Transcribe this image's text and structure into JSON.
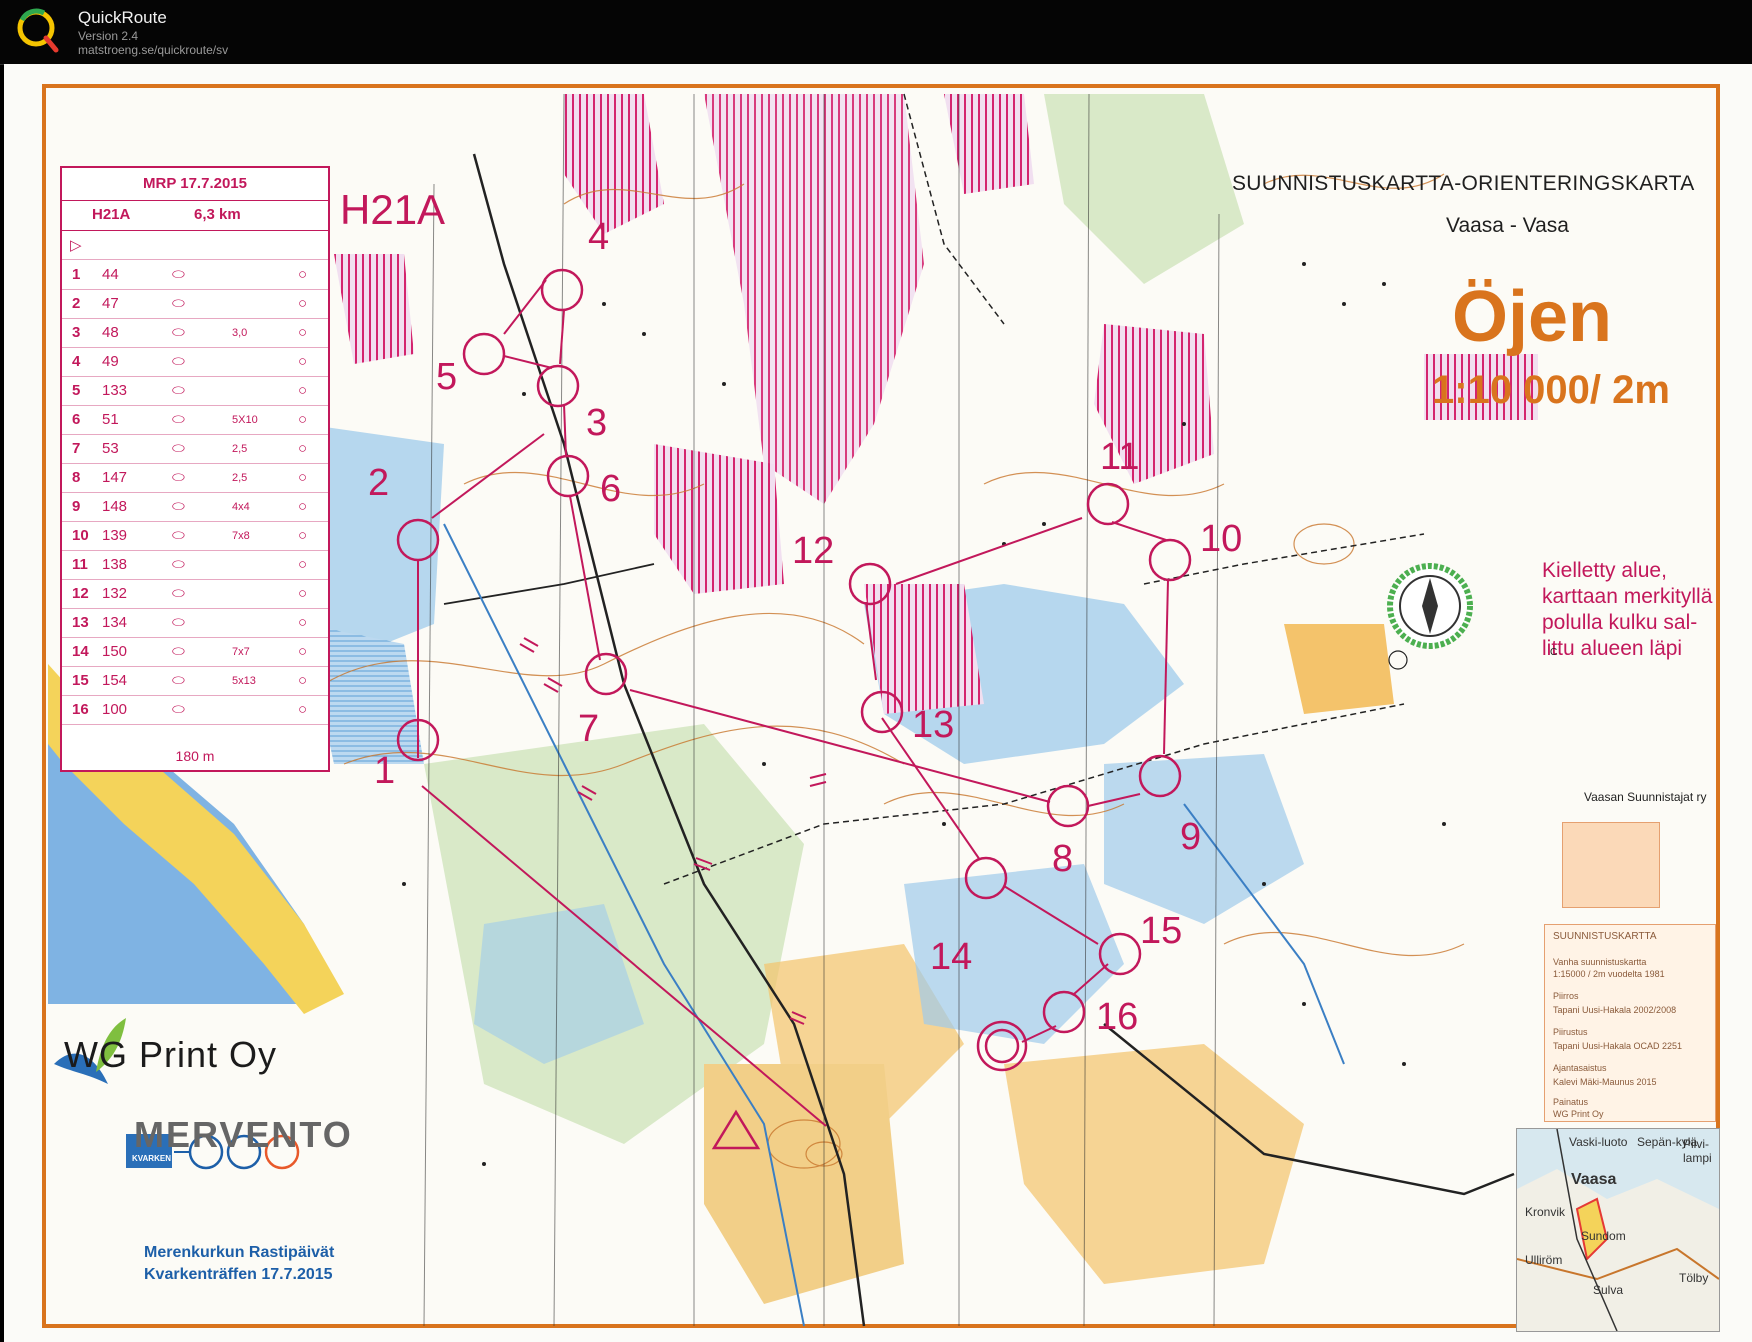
{
  "app": {
    "title": "QuickRoute",
    "version": "Version 2.4",
    "url": "matstroeng.se/quickroute/sv"
  },
  "map": {
    "title_top": "SUUNNISTUSKARTTA-ORIENTERINGSKARTA",
    "region": "Vaasa - Vasa",
    "name": "Öjen",
    "scale": "1:10 000/ 2m",
    "class_label": "H21A",
    "forbidden_area": [
      "Kielletty alue,",
      "karttaan merkityllä",
      "polulla kulku sal-",
      "littu alueen läpi"
    ],
    "copyright": "Vaasan Suunnistajat ry",
    "copyright_symbol": "C",
    "sponsors": {
      "wg": "WG Print Oy",
      "mervento": "MERVENTO"
    },
    "event": {
      "line1": "Merenkurkun Rastipäivät",
      "line2": "Kvarkenträffen  17.7.2015"
    },
    "kvarken_logo": "KVARKEN"
  },
  "description_sheet": {
    "event": "MRP 17.7.2015",
    "class": "H21A",
    "length": "6,3 km",
    "controls": [
      {
        "n": "1",
        "code": "44",
        "size": ""
      },
      {
        "n": "2",
        "code": "47",
        "size": ""
      },
      {
        "n": "3",
        "code": "48",
        "size": "3,0"
      },
      {
        "n": "4",
        "code": "49",
        "size": ""
      },
      {
        "n": "5",
        "code": "133",
        "size": ""
      },
      {
        "n": "6",
        "code": "51",
        "size": "5X10"
      },
      {
        "n": "7",
        "code": "53",
        "size": "2,5"
      },
      {
        "n": "8",
        "code": "147",
        "size": "2,5"
      },
      {
        "n": "9",
        "code": "148",
        "size": "4x4"
      },
      {
        "n": "10",
        "code": "139",
        "size": "7x8"
      },
      {
        "n": "11",
        "code": "138",
        "size": ""
      },
      {
        "n": "12",
        "code": "132",
        "size": ""
      },
      {
        "n": "13",
        "code": "134",
        "size": ""
      },
      {
        "n": "14",
        "code": "150",
        "size": "7x7"
      },
      {
        "n": "15",
        "code": "154",
        "size": "5x13"
      },
      {
        "n": "16",
        "code": "100",
        "size": ""
      }
    ],
    "finish_distance": "180 m"
  },
  "course_controls": [
    "1",
    "2",
    "3",
    "4",
    "5",
    "6",
    "7",
    "8",
    "9",
    "10",
    "11",
    "12",
    "13",
    "14",
    "15",
    "16"
  ],
  "legend": {
    "title": "SUUNNISTUSKARTTA",
    "lines": [
      "Vanha suunnistuskartta",
      "1:15000 / 2m vuodelta 1981",
      "Piirros",
      "Tapani Uusi-Hakala 2002/2008",
      "Piirustus",
      "Tapani Uusi-Hakala OCAD 2251",
      "Ajantasaistus",
      "Kalevi Mäki-Maunus 2015",
      "Painatus",
      "WG Print Oy"
    ]
  },
  "inset_map": {
    "labels": [
      "Vaski-luoto",
      "Vaasa",
      "Sepän-kylä",
      "Pilvi-lampi",
      "Kronvik",
      "Sundom",
      "Tölby",
      "Sulva",
      "Ulliröm"
    ]
  },
  "colors": {
    "course": "#c2185b",
    "forest": "#fbfbf8",
    "water": "#8fc4e8",
    "open": "#f4c36b",
    "contour": "#c8762c",
    "border": "#d9741d"
  }
}
